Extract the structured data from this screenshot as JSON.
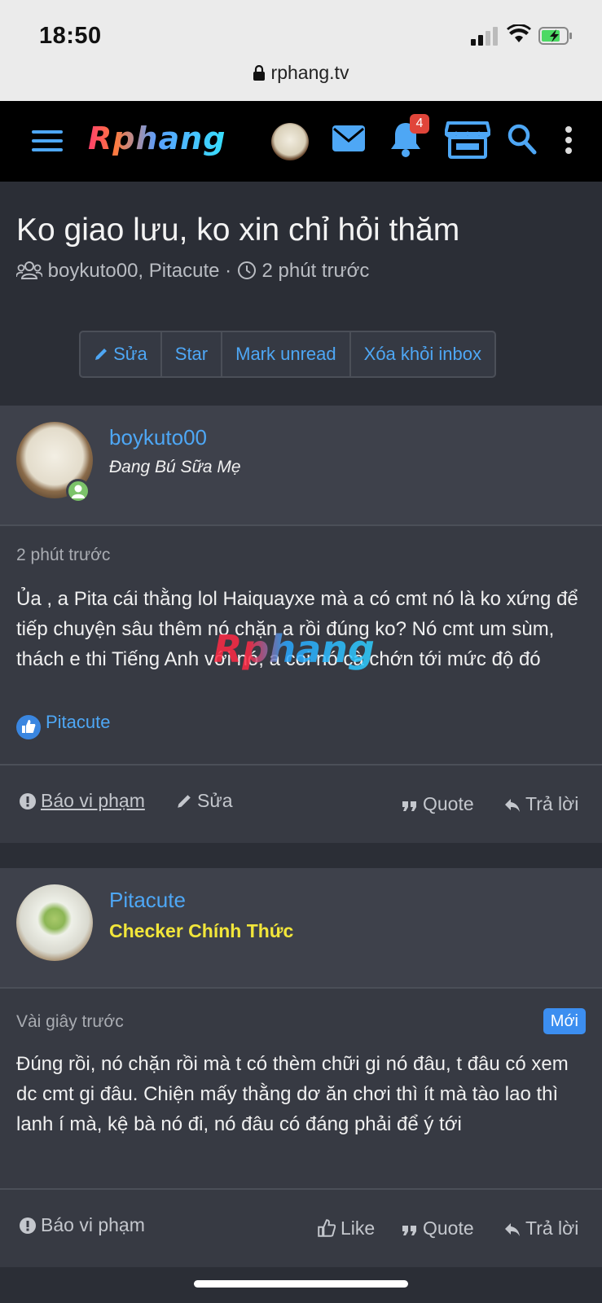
{
  "status": {
    "time": "18:50",
    "url": "rphang.tv"
  },
  "navbar": {
    "logo_text": "Rphang",
    "notification_count": "4",
    "icons": [
      "menu-icon",
      "avatar",
      "mail-icon",
      "bell-icon",
      "store-icon",
      "search-icon",
      "more-vertical-icon"
    ]
  },
  "thread": {
    "title": "Ko giao lưu, ko xin chỉ hỏi thăm",
    "participants": "boykuto00, Pitacute",
    "separator": "·",
    "time": "2 phút trước",
    "actions": {
      "edit": "Sửa",
      "star": "Star",
      "mark_unread": "Mark unread",
      "delete_inbox": "Xóa khỏi inbox"
    }
  },
  "posts": [
    {
      "username": "boykuto00",
      "user_title": "Đang Bú Sữa Mẹ",
      "time": "2 phút trước",
      "body": "Ủa , a Pita cái thằng lol Haiquayxe mà a có cmt nó là ko xứng để tiếp chuyện sâu thêm nó chặn a rồi đúng ko? Nó cmt um sùm, thách e thi Tiếng Anh với nó, a coi nó cà chớn tới mức độ đó",
      "liked_by": "Pitacute",
      "footer": {
        "report": "Báo vi phạm",
        "edit": "Sửa",
        "quote": "Quote",
        "reply": "Trả lời"
      }
    },
    {
      "username": "Pitacute",
      "user_title": "Checker Chính Thức",
      "time": "Vài giây trước",
      "new_badge": "Mới",
      "body": "Đúng rồi, nó chặn rồi mà t có thèm chữi gi nó đâu, t đâu có xem dc cmt gi đâu. Chiện mấy thằng dơ ăn chơi thì ít mà tào lao thì lanh í mà, kệ bà nó đi, nó đâu có đáng phải để ý tới",
      "footer": {
        "report": "Báo vi phạm",
        "like": "Like",
        "quote": "Quote",
        "reply": "Trả lời"
      }
    }
  ],
  "watermark": "Rphang",
  "colors": {
    "accent": "#4ea7f5",
    "background": "#2b2e36",
    "post_bg": "#373a43",
    "badge_red": "#e0453a",
    "user_title_yellow": "#f2e63a",
    "online_green": "#7cc36a"
  }
}
